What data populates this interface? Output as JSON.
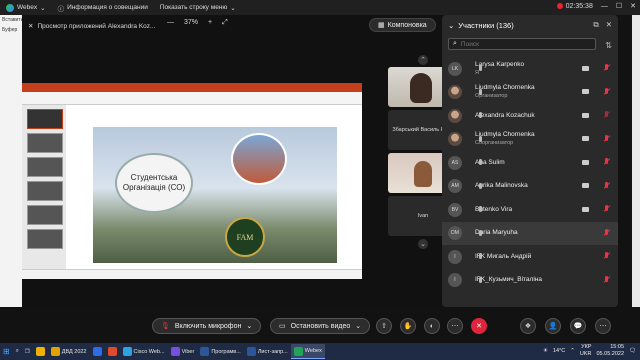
{
  "titlebar": {
    "app_name": "Webex",
    "meeting_info": "Информация о совещании",
    "menu_toggle": "Показать строку меню",
    "timer": "02:35:38"
  },
  "left_strip": {
    "items": [
      "Вставить",
      "Буфер"
    ]
  },
  "share": {
    "title": "Просмотр приложений Alexandra Koz...",
    "zoom_value": "37%",
    "layout_label": "Компоновка"
  },
  "slide": {
    "circle_text": "Студентська Організація (СО)",
    "logo_text": "FAM"
  },
  "videos": {
    "tile1_name": "Збарський Василь Куз...",
    "tile2_name": "Ivan"
  },
  "panel": {
    "title": "Участники (136)",
    "search_placeholder": "Поиск",
    "participants": [
      {
        "initials": "LK",
        "name": "Larysa Karpenko",
        "role": "Я",
        "photo": false,
        "cam": true,
        "muted": true,
        "highlight": false
      },
      {
        "initials": "",
        "name": "Liudmyla Chornenka",
        "role": "Организатор",
        "photo": true,
        "cam": true,
        "muted": true,
        "highlight": false
      },
      {
        "initials": "",
        "name": "Alexandra Kozachuk",
        "role": "",
        "photo": true,
        "cam": true,
        "muted": false,
        "highlight": false
      },
      {
        "initials": "",
        "name": "Liudmyla Chornenka",
        "role": "Соорганизатор",
        "photo": true,
        "cam": true,
        "muted": true,
        "highlight": false
      },
      {
        "initials": "AS",
        "name": "Ana Sulim",
        "role": "",
        "photo": false,
        "cam": true,
        "muted": true,
        "highlight": false
      },
      {
        "initials": "AM",
        "name": "Aurika Malinovska",
        "role": "",
        "photo": false,
        "cam": true,
        "muted": true,
        "highlight": false
      },
      {
        "initials": "BV",
        "name": "Butenko Vira",
        "role": "",
        "photo": false,
        "cam": true,
        "muted": true,
        "highlight": false
      },
      {
        "initials": "DM",
        "name": "Daria Maryuha",
        "role": "",
        "photo": false,
        "cam": false,
        "muted": true,
        "highlight": true
      },
      {
        "initials": "I",
        "name": "IFK Мигаль Андрій",
        "role": "",
        "photo": false,
        "cam": false,
        "muted": true,
        "highlight": false
      },
      {
        "initials": "I",
        "name": "IFK_Кузьмич_Віталіна",
        "role": "",
        "photo": false,
        "cam": false,
        "muted": true,
        "highlight": false
      }
    ]
  },
  "controls": {
    "mic_label": "Включить микрофон",
    "video_label": "Остановить видео"
  },
  "taskbar": {
    "apps": [
      {
        "label": "",
        "color": "#f0b400",
        "active": false
      },
      {
        "label": "ДВД 2022",
        "color": "#e0a300",
        "active": false
      },
      {
        "label": "",
        "color": "#2e6be6",
        "active": false
      },
      {
        "label": "",
        "color": "#e34a2a",
        "active": false
      },
      {
        "label": "Cisco Web...",
        "color": "#2aa5e0",
        "active": false
      },
      {
        "label": "Viber",
        "color": "#7a4fe0",
        "active": false
      },
      {
        "label": "Програмв...",
        "color": "#2b579a",
        "active": false
      },
      {
        "label": "Лист-запр...",
        "color": "#2b579a",
        "active": false
      },
      {
        "label": "Webex",
        "color": "#22a35a",
        "active": true
      }
    ],
    "weather": "14°C",
    "lang_top": "УКР",
    "lang_bottom": "UKR",
    "time": "15:05",
    "date": "05.05.2022"
  },
  "colors": {
    "accent_red": "#e0243c",
    "panel_bg": "#2a2a2a"
  }
}
